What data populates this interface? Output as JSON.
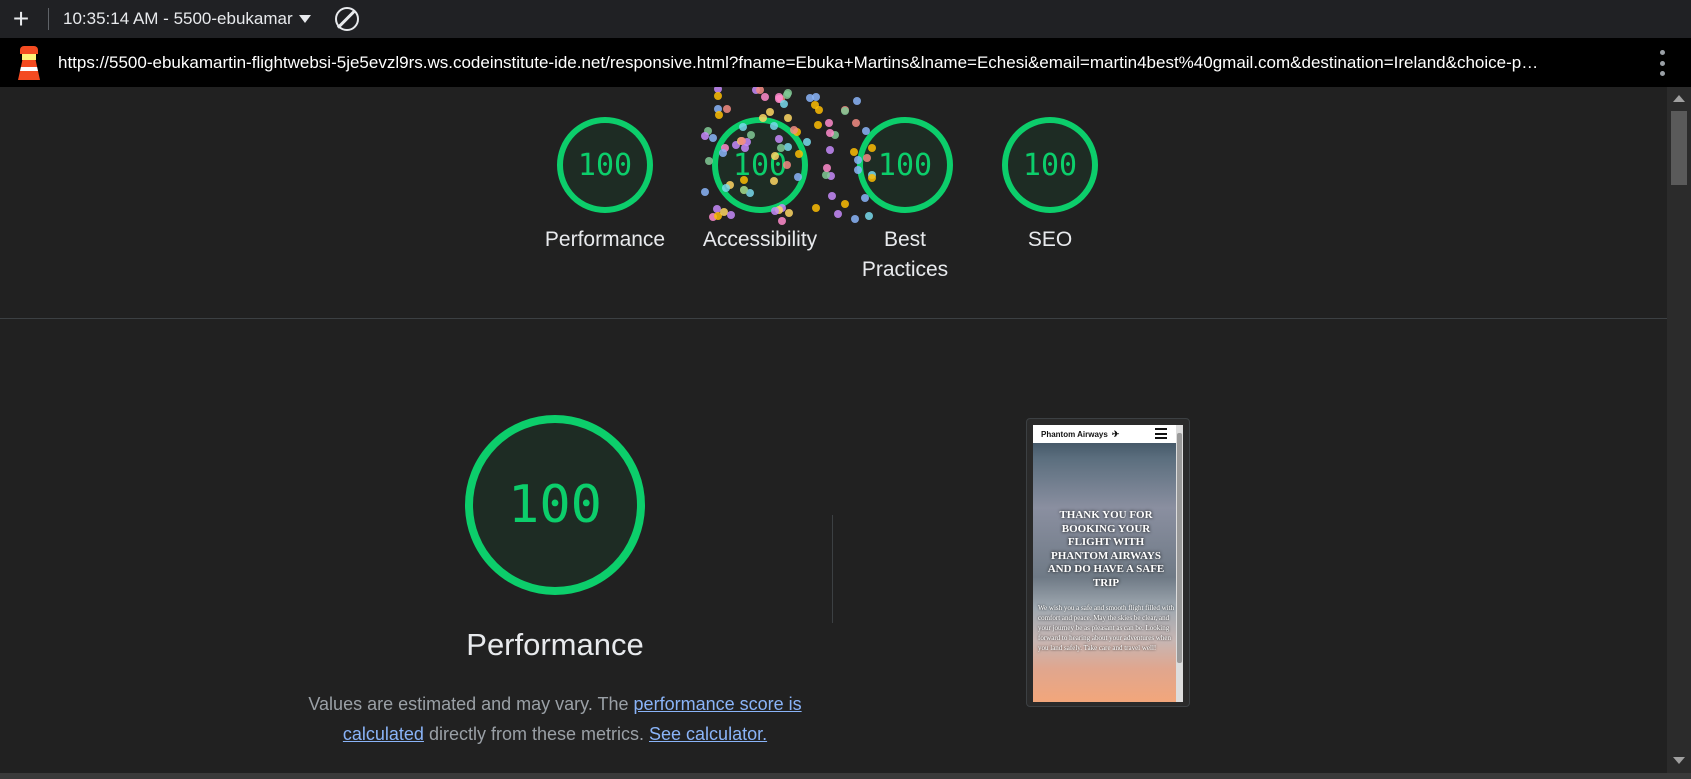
{
  "toolbar": {
    "new_tab_icon": "plus-icon",
    "title": "10:35:14 AM - 5500-ebukamar",
    "dropdown_icon": "caret-down-icon",
    "block_icon": "block-icon"
  },
  "urlbar": {
    "icon": "lighthouse-icon",
    "url": "https://5500-ebukamartin-flightwebsi-5je5evzl9rs.ws.codeinstitute-ide.net/responsive.html?fname=Ebuka+Martins&lname=Echesi&email=martin4best%40gmail.com&destination=Ireland&choice-p…",
    "menu_icon": "kebab-menu-icon"
  },
  "colors": {
    "pass": "#0cce6b",
    "background": "#212121",
    "link": "#8ab4f8"
  },
  "gauges": [
    {
      "score": "100",
      "label": "Performance"
    },
    {
      "score": "100",
      "label": "Accessibility"
    },
    {
      "score": "100",
      "label": "Best Practices"
    },
    {
      "score": "100",
      "label": "SEO"
    }
  ],
  "performance": {
    "score": "100",
    "title": "Performance",
    "desc_prefix": "Values are estimated and may vary. The ",
    "link1": "performance score is calculated",
    "desc_middle": " directly from these metrics. ",
    "link2": "See calculator."
  },
  "screenshot": {
    "brand": "Phantom Airways",
    "plane_icon": "plane-icon",
    "menu_icon": "hamburger-icon",
    "heading": "THANK YOU FOR BOOKING YOUR FLIGHT WITH PHANTOM AIRWAYS AND DO HAVE A SAFE TRIP",
    "body": "We wish you a safe and smooth flight filled with comfort and peace. May the skies be clear, and your journey be as pleasant as can be. Looking forward to hearing about your adventures when you land safely. Take care and travel well!"
  }
}
